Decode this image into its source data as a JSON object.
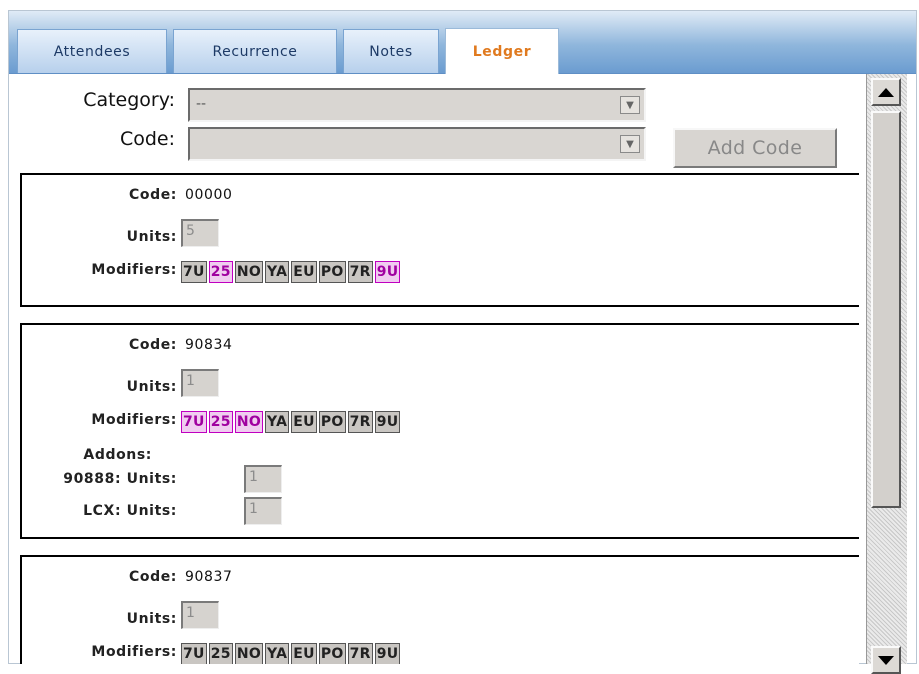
{
  "tabs": [
    {
      "label": "Attendees"
    },
    {
      "label": "Recurrence"
    },
    {
      "label": "Notes"
    },
    {
      "label": "Ledger",
      "active": true
    }
  ],
  "form": {
    "category_label": "Category:",
    "category_value": "--",
    "code_label": "Code:",
    "code_value": "",
    "add_code_label": "Add Code"
  },
  "labels": {
    "code": "Code:",
    "units": "Units:",
    "modifiers": "Modifiers:",
    "addons": "Addons:"
  },
  "ledger_entries": [
    {
      "code": "00000",
      "units": "5",
      "modifiers": [
        {
          "code": "7U",
          "selected": false
        },
        {
          "code": "25",
          "selected": true
        },
        {
          "code": "NO",
          "selected": false
        },
        {
          "code": "YA",
          "selected": false
        },
        {
          "code": "EU",
          "selected": false
        },
        {
          "code": "PO",
          "selected": false
        },
        {
          "code": "7R",
          "selected": false
        },
        {
          "code": "9U",
          "selected": true
        }
      ]
    },
    {
      "code": "90834",
      "units": "1",
      "modifiers": [
        {
          "code": "7U",
          "selected": true
        },
        {
          "code": "25",
          "selected": true
        },
        {
          "code": "NO",
          "selected": true
        },
        {
          "code": "YA",
          "selected": false
        },
        {
          "code": "EU",
          "selected": false
        },
        {
          "code": "PO",
          "selected": false
        },
        {
          "code": "7R",
          "selected": false
        },
        {
          "code": "9U",
          "selected": false
        }
      ],
      "addons": [
        {
          "code": "90888:",
          "units_label": "Units:",
          "units": "1"
        },
        {
          "code": "LCX:",
          "units_label": "Units:",
          "units": "1"
        }
      ]
    },
    {
      "code": "90837",
      "units": "1",
      "modifiers": [
        {
          "code": "7U",
          "selected": false
        },
        {
          "code": "25",
          "selected": false
        },
        {
          "code": "NO",
          "selected": false
        },
        {
          "code": "YA",
          "selected": false
        },
        {
          "code": "EU",
          "selected": false
        },
        {
          "code": "PO",
          "selected": false
        },
        {
          "code": "7R",
          "selected": false
        },
        {
          "code": "9U",
          "selected": false
        }
      ]
    }
  ],
  "colors": {
    "active_tab_text": "#e07a1f",
    "selected_modifier": "#c000c0"
  }
}
